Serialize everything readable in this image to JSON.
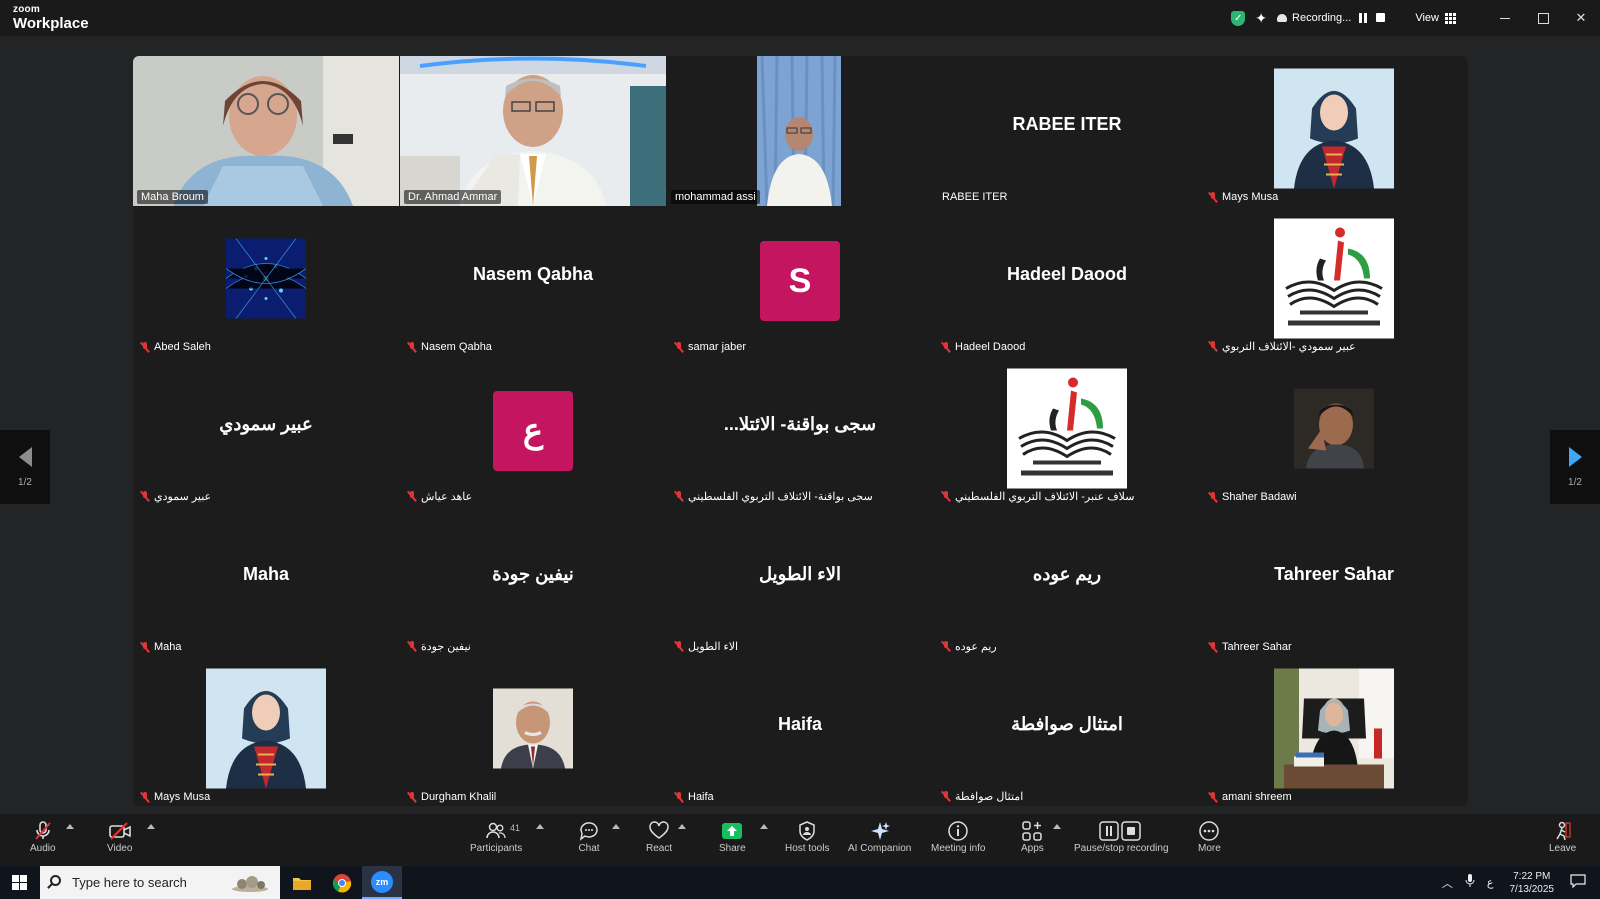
{
  "app": {
    "brand_small": "zoom",
    "brand_big": "Workplace",
    "recording_label": "Recording...",
    "view_label": "View"
  },
  "colors": {
    "speaker_border": "#22c55e",
    "avatar_letter_bg": "#c41560",
    "mute_red": "#e03535",
    "next_arrow": "#3ea7f7"
  },
  "pager": {
    "prev_label": "1/2",
    "next_label": "1/2"
  },
  "tiles": [
    {
      "name": "Maha Broum",
      "kind": "video",
      "muted": false
    },
    {
      "name": "Dr. Ahmad Ammar",
      "kind": "video",
      "muted": false
    },
    {
      "name": "mohammad assi",
      "kind": "video",
      "muted": false,
      "speaker": true
    },
    {
      "name": "RABEE ITER",
      "kind": "name",
      "display": "RABEE ITER",
      "muted": false
    },
    {
      "name": "Mays Musa",
      "kind": "photo",
      "muted": true
    },
    {
      "name": "Abed Saleh",
      "kind": "photo",
      "muted": true
    },
    {
      "name": "Nasem Qabha",
      "kind": "name",
      "display": "Nasem Qabha",
      "muted": true
    },
    {
      "name": "samar jaber",
      "kind": "letter",
      "letter": "S",
      "muted": true
    },
    {
      "name": "Hadeel Daood",
      "kind": "name",
      "display": "Hadeel Daood",
      "muted": true
    },
    {
      "name": "عبير سمودي -الائتلاف التربوي",
      "kind": "logo",
      "muted": true
    },
    {
      "name": "عبير سمودي",
      "kind": "name",
      "display": "عبير سمودي",
      "muted": true
    },
    {
      "name": "عاهد عياش",
      "kind": "letter",
      "letter": "ع",
      "muted": true
    },
    {
      "name": "سجى بواقنة- الائتلاف التربوي الفلسطيني",
      "kind": "name",
      "display": "...سجى بواقنة- الائتلا",
      "muted": true
    },
    {
      "name": "سلاف عنبر- الائتلاف التربوي الفلسطيني",
      "kind": "logo",
      "muted": true
    },
    {
      "name": "Shaher Badawi",
      "kind": "photo",
      "muted": true
    },
    {
      "name": "Maha",
      "kind": "name",
      "display": "Maha",
      "muted": true
    },
    {
      "name": "نيفين جودة",
      "kind": "name",
      "display": "نيفين جودة",
      "muted": true
    },
    {
      "name": "الاء الطويل",
      "kind": "name",
      "display": "الاء الطويل",
      "muted": true
    },
    {
      "name": "ريم  عوده",
      "kind": "name",
      "display": "ريم  عوده",
      "muted": true
    },
    {
      "name": "Tahreer Sahar",
      "kind": "name",
      "display": "Tahreer Sahar",
      "muted": true
    },
    {
      "name": "Mays Musa",
      "kind": "photo",
      "muted": true
    },
    {
      "name": "Durgham Khalil",
      "kind": "photo",
      "muted": true
    },
    {
      "name": "Haifa",
      "kind": "name",
      "display": "Haifa",
      "muted": true
    },
    {
      "name": "امتثال صوافطة",
      "kind": "name",
      "display": "امتثال صوافطة",
      "muted": true
    },
    {
      "name": "amani shreem",
      "kind": "photo",
      "muted": true
    }
  ],
  "toolbar": {
    "audio": "Audio",
    "video": "Video",
    "participants": "Participants",
    "participants_count": "41",
    "chat": "Chat",
    "react": "React",
    "share": "Share",
    "host_tools": "Host tools",
    "ai_companion": "AI Companion",
    "meeting_info": "Meeting info",
    "apps": "Apps",
    "pause_stop": "Pause/stop recording",
    "more": "More",
    "leave": "Leave"
  },
  "taskbar": {
    "search_placeholder": "Type here to search",
    "zoom_app": "zm",
    "lang": "ع",
    "time": "7:22 PM",
    "date": "7/13/2025"
  }
}
